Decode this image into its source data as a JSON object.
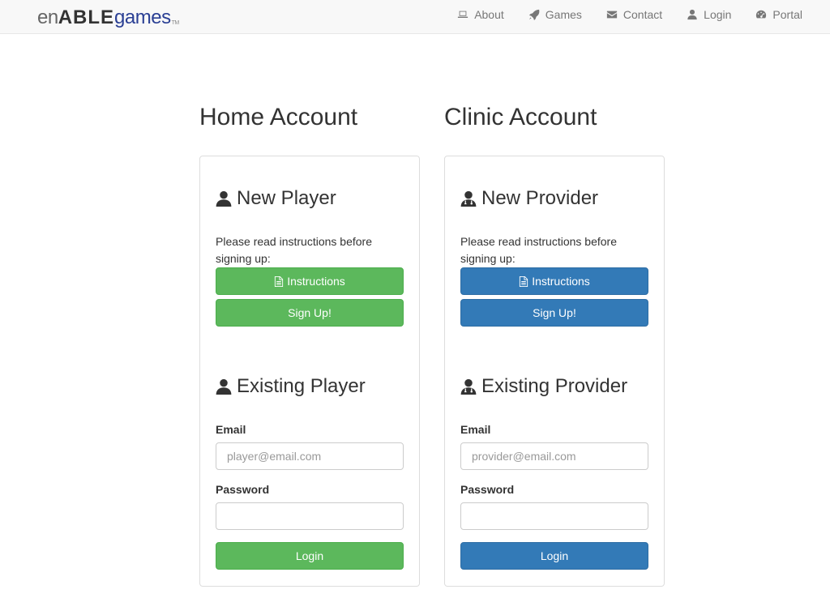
{
  "brand": {
    "part1": "en",
    "part2": "ABLE",
    "part3": "games",
    "tm": "TM"
  },
  "nav": [
    {
      "label": "About",
      "icon": "laptop-icon"
    },
    {
      "label": "Games",
      "icon": "rocket-icon"
    },
    {
      "label": "Contact",
      "icon": "envelope-icon"
    },
    {
      "label": "Login",
      "icon": "user-icon"
    },
    {
      "label": "Portal",
      "icon": "dashboard-icon"
    }
  ],
  "home": {
    "title": "Home Account",
    "new_title": "New Player",
    "note": "Please read instructions before signing up:",
    "instructions": "Instructions",
    "signup": "Sign Up!",
    "existing_title": "Existing Player",
    "email_label": "Email",
    "email_placeholder": "player@email.com",
    "password_label": "Password",
    "login": "Login",
    "accent": "#5cb85c"
  },
  "clinic": {
    "title": "Clinic Account",
    "new_title": "New Provider",
    "note": "Please read instructions before signing up:",
    "instructions": "Instructions",
    "signup": "Sign Up!",
    "existing_title": "Existing Provider",
    "email_label": "Email",
    "email_placeholder": "provider@email.com",
    "password_label": "Password",
    "login": "Login",
    "accent": "#337ab7"
  }
}
